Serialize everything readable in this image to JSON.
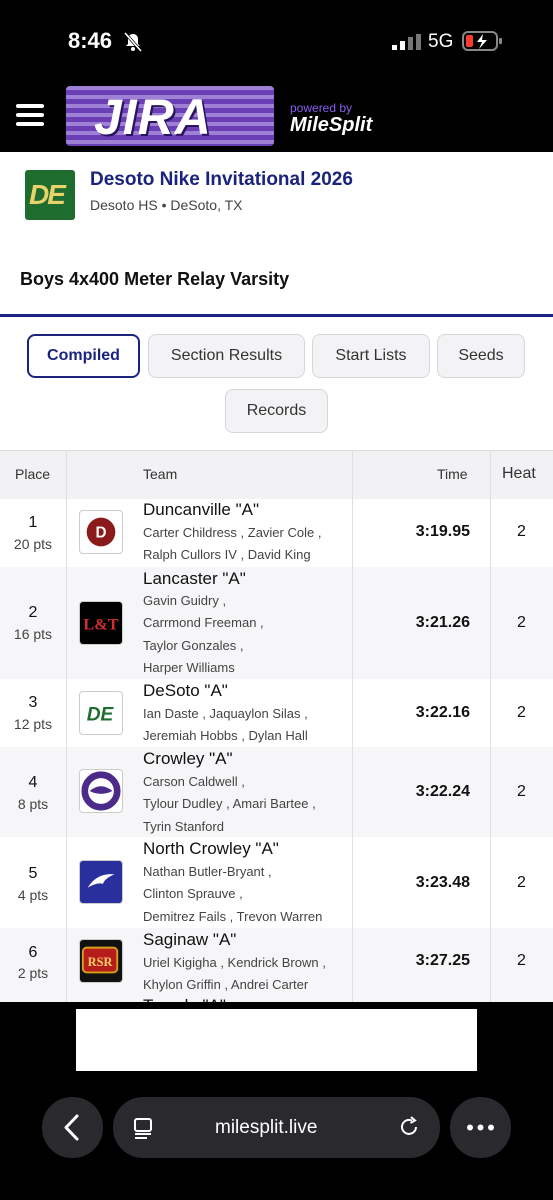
{
  "status_bar": {
    "time": "8:46",
    "network": "5G"
  },
  "header": {
    "logo_text": "JIRA",
    "powered_by": "powered by",
    "brand": "MileSplit"
  },
  "meet": {
    "title": "Desoto Nike Invitational 2026",
    "subtitle": "Desoto HS • DeSoto, TX",
    "logo_text": "DE"
  },
  "event": {
    "title": "Boys 4x400 Meter Relay Varsity"
  },
  "tabs": [
    "Compiled",
    "Section Results",
    "Start Lists",
    "Seeds",
    "Records"
  ],
  "table": {
    "headers": {
      "place": "Place",
      "team": "Team",
      "time": "Time",
      "heat": "Heat"
    },
    "rows": [
      {
        "place": "1",
        "pts": "20 pts",
        "team": "Duncanville \"A\"",
        "athletes": [
          "Carter Childress , Zavier Cole ,",
          "Ralph Cullors IV , David King"
        ],
        "time": "3:19.95",
        "heat": "2"
      },
      {
        "place": "2",
        "pts": "16 pts",
        "team": "Lancaster \"A\"",
        "athletes": [
          "Gavin Guidry ,",
          "Carrmond Freeman ,",
          "Taylor Gonzales ,",
          "Harper Williams"
        ],
        "time": "3:21.26",
        "heat": "2"
      },
      {
        "place": "3",
        "pts": "12 pts",
        "team": "DeSoto \"A\"",
        "athletes": [
          "Ian Daste , Jaquaylon Silas ,",
          "Jeremiah Hobbs , Dylan Hall"
        ],
        "time": "3:22.16",
        "heat": "2"
      },
      {
        "place": "4",
        "pts": "8 pts",
        "team": "Crowley \"A\"",
        "athletes": [
          "Carson Caldwell ,",
          "Tylour Dudley , Amari Bartee ,",
          "Tyrin Stanford"
        ],
        "time": "3:22.24",
        "heat": "2"
      },
      {
        "place": "5",
        "pts": "4 pts",
        "team": "North Crowley \"A\"",
        "athletes": [
          "Nathan Butler-Bryant ,",
          "Clinton Sprauve ,",
          "Demitrez Fails , Trevon Warren"
        ],
        "time": "3:23.48",
        "heat": "2"
      },
      {
        "place": "6",
        "pts": "2 pts",
        "team": "Saginaw \"A\"",
        "athletes": [
          "Uriel Kigigha , Kendrick Brown ,",
          "Khylon Griffin , Andrei Carter"
        ],
        "time": "3:27.25",
        "heat": "2"
      }
    ],
    "partial_next_team": "Temple \"A\""
  },
  "browser": {
    "url": "milesplit.live"
  },
  "colors": {
    "navy": "#1a237e",
    "purple": "#6a3fb5"
  }
}
